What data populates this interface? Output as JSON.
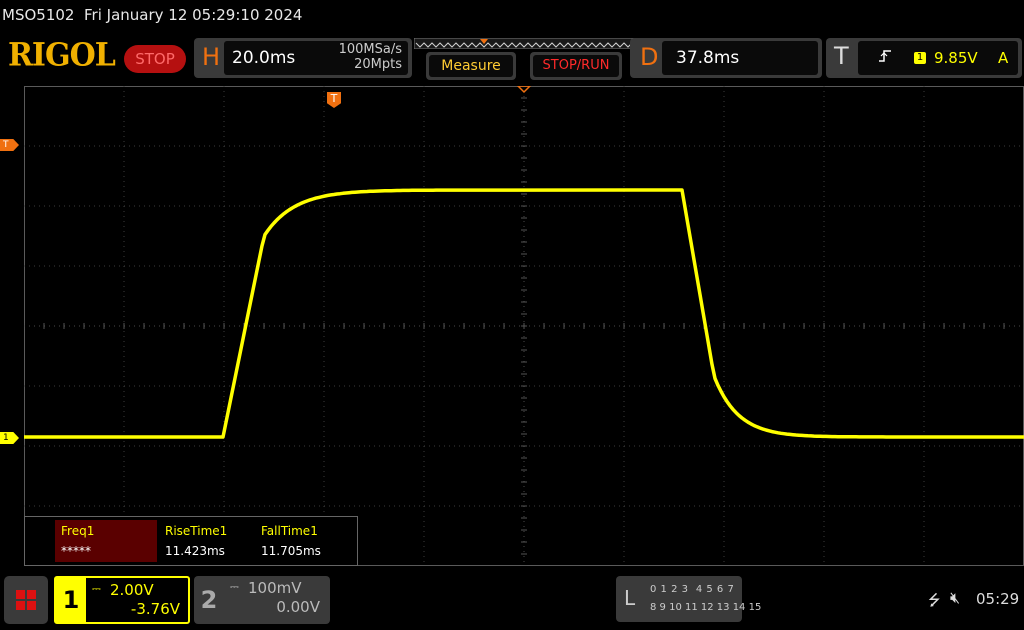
{
  "title_bar": {
    "model": "MSO5102",
    "datetime": "Fri January 12 05:29:10 2024"
  },
  "header": {
    "brand": "RIGOL",
    "run_state": "STOP",
    "horizontal": {
      "letter": "H",
      "timebase": "20.0ms",
      "sample_rate": "100MSa/s",
      "memory_depth": "20Mpts"
    },
    "measure_label": "Measure",
    "stop_run_label": "STOP/RUN",
    "delay": {
      "letter": "D",
      "value": "37.8ms"
    },
    "trigger": {
      "letter": "T",
      "source": "1",
      "level": "9.85V",
      "mode": "A",
      "edge_icon": "rising-edge-icon"
    }
  },
  "markers": {
    "trigger_level": "T",
    "channel1": "1",
    "trigger_time": "T"
  },
  "measurements": [
    {
      "name": "Freq1",
      "value": "*****"
    },
    {
      "name": "RiseTime1",
      "value": "11.423ms"
    },
    {
      "name": "FallTime1",
      "value": "11.705ms"
    }
  ],
  "channels": [
    {
      "number": "1",
      "scale": "2.00V",
      "offset": "-3.76V",
      "color": "#ffff00",
      "active": true
    },
    {
      "number": "2",
      "scale": "100mV",
      "offset": "0.00V",
      "color": "#bbbbbb",
      "active": false
    }
  ],
  "logic_analyzer": {
    "letter": "L",
    "row1": "0 1 2 3  4 5 6 7",
    "row2": "8 9 10 11 12 13 14 15"
  },
  "status": {
    "clock": "05:29",
    "usb_icon": "usb-icon",
    "sound_icon": "sound-muted-icon"
  },
  "colors": {
    "trace": "#ffff00",
    "accent": "#f07010",
    "stop": "#b51010",
    "grid": "#3c3c3c"
  }
}
